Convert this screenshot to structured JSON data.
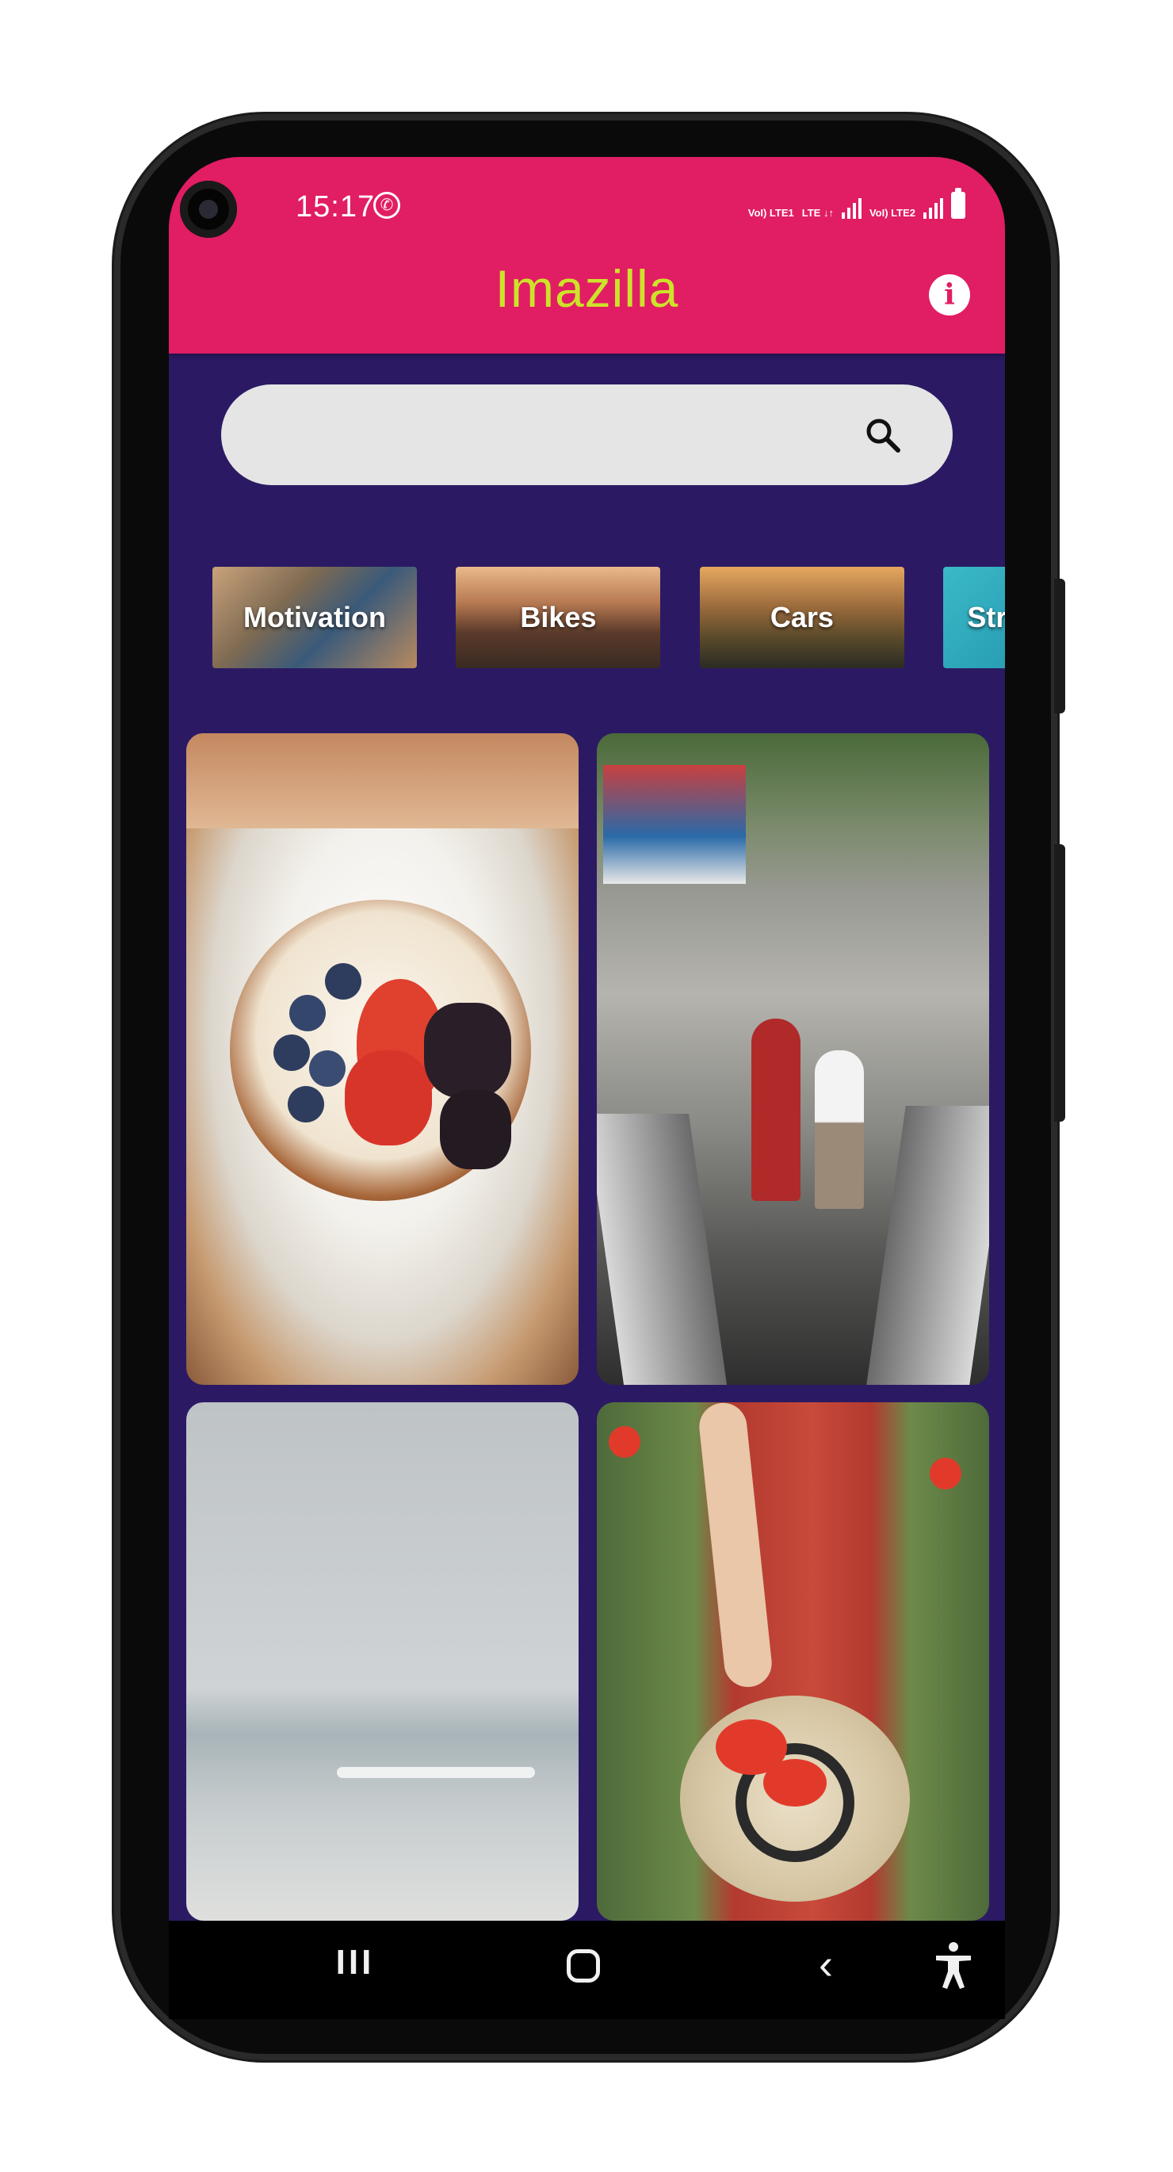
{
  "status_bar": {
    "time": "15:17",
    "network_labels": [
      "VoI) LTE1",
      "LTE ↓↑",
      "VoI) LTE2"
    ]
  },
  "app_bar": {
    "title": "Imazilla",
    "info_icon": "info-icon",
    "info_glyph": "i"
  },
  "search": {
    "value": "",
    "placeholder": "",
    "icon": "search-icon"
  },
  "categories": [
    {
      "label": "Motivation"
    },
    {
      "label": "Bikes"
    },
    {
      "label": "Cars"
    },
    {
      "label": "Str"
    }
  ],
  "photos": [
    {
      "subject": "plate-with-berries"
    },
    {
      "subject": "children-on-escalator"
    },
    {
      "subject": "beach-and-sea"
    },
    {
      "subject": "woman-with-hat-in-poppy-field"
    }
  ],
  "nav_bar": {
    "recent_glyph": "III",
    "back_glyph": "‹"
  },
  "colors": {
    "app_bar": "#e11d63",
    "title": "#cde22a",
    "background": "#2b1a63",
    "search_bar": "#e5e5e5"
  }
}
